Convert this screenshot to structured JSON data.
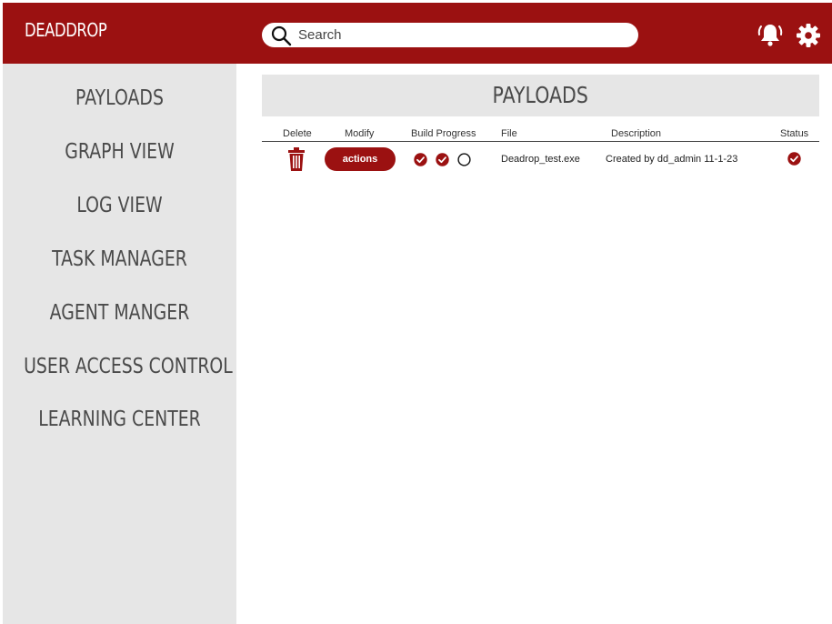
{
  "app": {
    "brand": "DEADDROP"
  },
  "header": {
    "search": {
      "placeholder": "Search",
      "value": ""
    },
    "icons": [
      "search-icon",
      "bell-icon",
      "gear-icon"
    ]
  },
  "sidebar": {
    "items": [
      {
        "label": "PAYLOADS"
      },
      {
        "label": "GRAPH VIEW"
      },
      {
        "label": "LOG VIEW"
      },
      {
        "label": "TASK MANAGER"
      },
      {
        "label": "AGENT MANGER"
      },
      {
        "label": "USER ACCESS CONTROL"
      },
      {
        "label": "LEARNING CENTER"
      }
    ]
  },
  "main": {
    "title": "PAYLOADS",
    "columns": [
      "Delete",
      "Modify",
      "Build Progress",
      "File",
      "Description",
      "Status"
    ],
    "rows": [
      {
        "modify_label": "actions",
        "build_progress": [
          "complete",
          "complete",
          "pending"
        ],
        "file": "Deadrop_test.exe",
        "description": "Created by dd_admin 11-1-23",
        "status": "complete"
      }
    ]
  },
  "colors": {
    "brand": "#9b1111",
    "sidebar_bg": "#e6e6e6",
    "text": "#4a4a4a"
  }
}
